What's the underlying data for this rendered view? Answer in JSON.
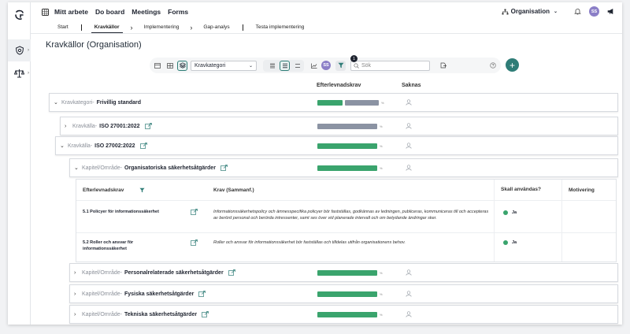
{
  "nav": {
    "items": [
      "Mitt arbete",
      "Do board",
      "Meetings",
      "Forms"
    ]
  },
  "org": {
    "label": "Organisation"
  },
  "user": {
    "initials": "SS"
  },
  "crumbs": [
    "Start",
    "Kravkällor",
    "Implementering",
    "Gap-analys",
    "Testa implementering"
  ],
  "page": {
    "title": "Kravkällor (Organisation)"
  },
  "toolbar": {
    "group_by": "Kravkategori",
    "search_placeholder": "Sök",
    "filter_count": "1",
    "avatar": "SS"
  },
  "columns": {
    "efterlevnad": "Efterlevnadskrav",
    "saknas": "Saknas"
  },
  "rows": [
    {
      "prefix": "Kravkategori",
      "sep": " - ",
      "name": "Frivillig standard",
      "green": 0,
      "gray": 0,
      "pct": ""
    },
    {
      "prefix": "Kravkälla",
      "sep": " - ",
      "name": "ISO 27001:2022",
      "green": 0,
      "gray": 1,
      "pct": "%"
    },
    {
      "prefix": "Kravkälla",
      "sep": " - ",
      "name": "ISO 27002:2022",
      "green": 1,
      "gray": 0,
      "pct": "%"
    },
    {
      "prefix": "Kapitel/Område",
      "sep": " - ",
      "name": "Organisatoriska säkerhetsåtgärder",
      "green": 1,
      "gray": 0,
      "pct": "%"
    },
    {
      "prefix": "Kapitel/Område",
      "sep": " - ",
      "name": "Personalrelaterade säkerhetsåtgärder",
      "green": 1,
      "gray": 0,
      "pct": "%"
    },
    {
      "prefix": "Kapitel/Område",
      "sep": " - ",
      "name": "Fysiska säkerhetsåtgärder",
      "green": 1,
      "gray": 0,
      "pct": "%"
    },
    {
      "prefix": "Kapitel/Område",
      "sep": " - ",
      "name": "Tekniska säkerhetsåtgärder",
      "green": 1,
      "gray": 0,
      "pct": "%"
    }
  ],
  "frivillig_pct": "%",
  "table": {
    "headers": {
      "krav": "Efterlevnadskrav",
      "summary": "Krav (Sammanf.)",
      "skall": "Skall användas?",
      "motivering": "Motivering"
    },
    "rows": [
      {
        "krav": "5.1 Policyer för informationssäkerhet",
        "summary": "Informationssäkerhetspolicy och ämnesspecifika policyer bör fastställas, godkännas av ledningen, publiceras, kommuniceras till och accepteras av berörd personal och berörda intressenter, samt ses över vid planerade intervall och om betydande ändringar sker.",
        "skall": "Ja"
      },
      {
        "krav": "5.2 Roller och ansvar för informationssäkerhet",
        "summary": "Roller och ansvar för informationssäkerhet bör fastställas och tilldelas utifrån organisationens behov.",
        "skall": "Ja"
      }
    ]
  },
  "colors": {
    "green": "#3aa46d",
    "gray": "#8b93a3",
    "accent": "#2f7d77"
  }
}
